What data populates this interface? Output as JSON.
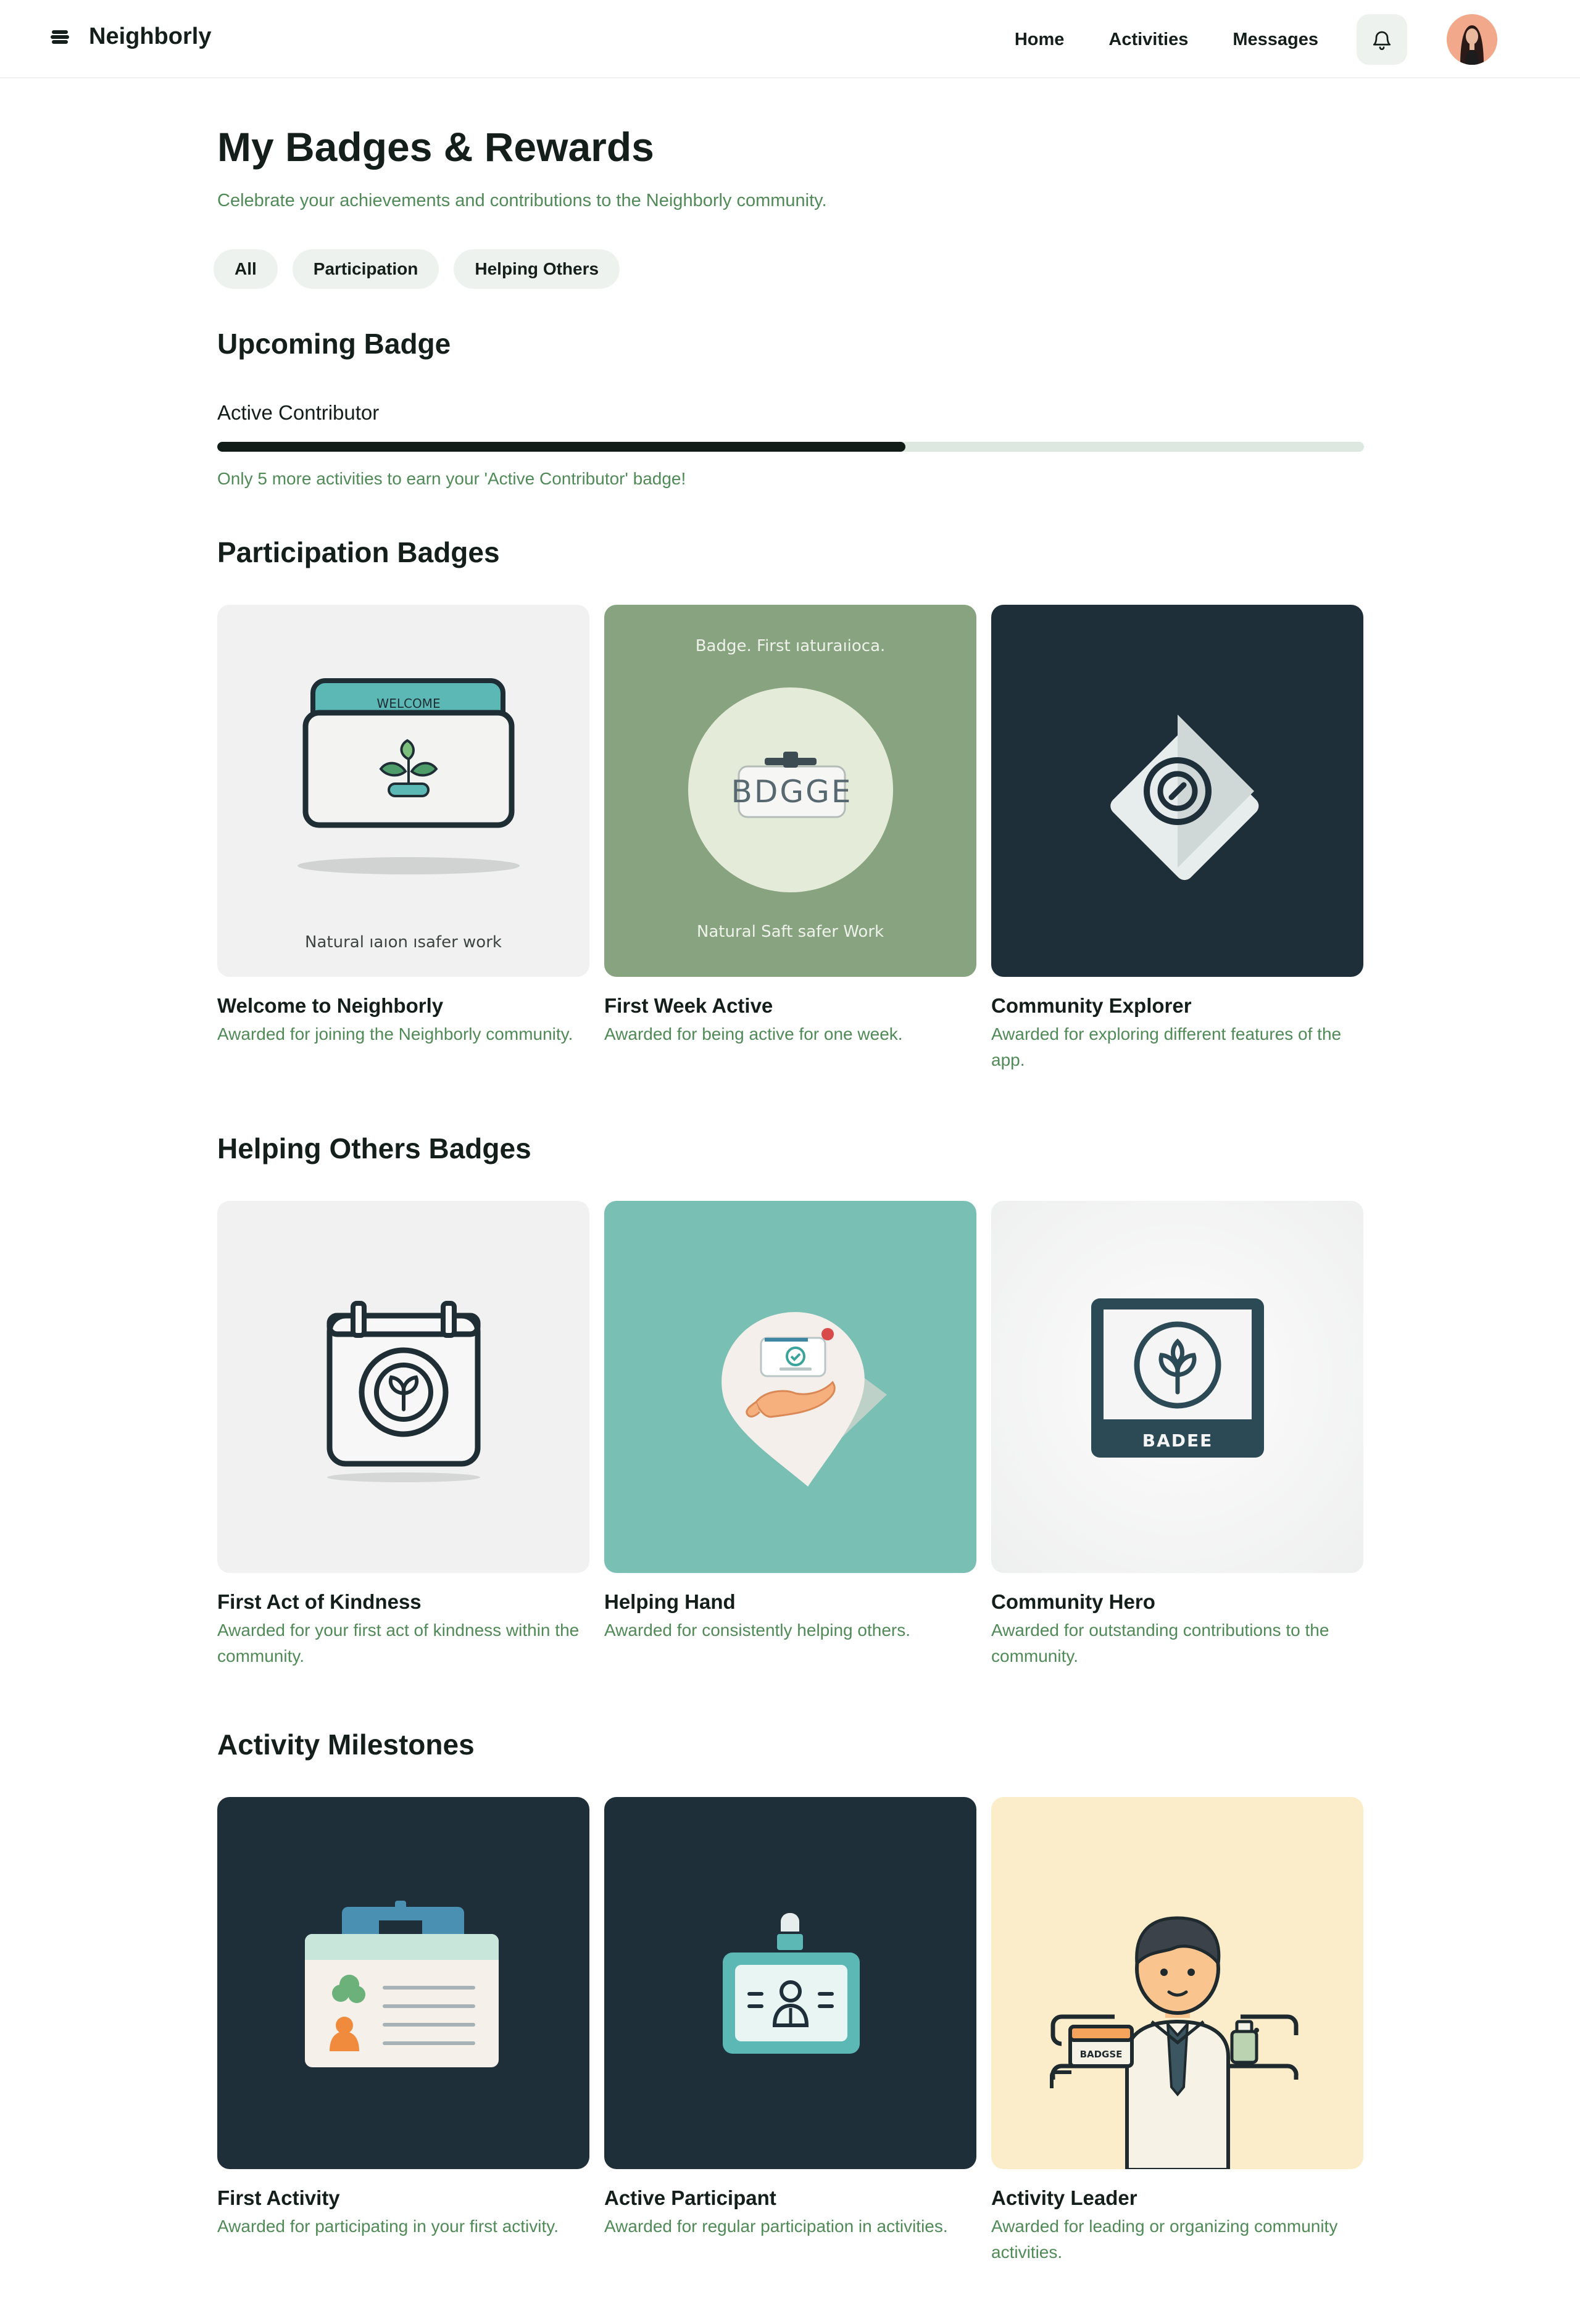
{
  "header": {
    "brand": "Neighborly",
    "nav": [
      "Home",
      "Activities",
      "Messages"
    ]
  },
  "page": {
    "title": "My Badges & Rewards",
    "subtitle": "Celebrate your achievements and contributions to the Neighborly community."
  },
  "filters": [
    "All",
    "Participation",
    "Helping Others"
  ],
  "upcoming": {
    "heading": "Upcoming Badge",
    "badge_name": "Active Contributor",
    "progress_fraction": 0.6,
    "note": "Only 5 more activities to earn your 'Active Contributor' badge!"
  },
  "sections": [
    {
      "title": "Participation Badges",
      "badges": [
        {
          "title": "Welcome to Neighborly",
          "desc": "Awarded for joining the Neighborly community.",
          "art_text": "WELCOME",
          "caption": "Natural ıaıon ısafer work"
        },
        {
          "title": "First Week Active",
          "desc": "Awarded for being active for one week.",
          "art_text": "BDGGE",
          "top_caption": "Badge. First ıaturaıioca.",
          "caption": "Natural Saft safer Work"
        },
        {
          "title": "Community Explorer",
          "desc": "Awarded for exploring different features of the app."
        }
      ]
    },
    {
      "title": "Helping Others Badges",
      "badges": [
        {
          "title": "First Act of Kindness",
          "desc": "Awarded for your first act of kindness within the community."
        },
        {
          "title": "Helping Hand",
          "desc": "Awarded for consistently helping others."
        },
        {
          "title": "Community Hero",
          "desc": "Awarded for outstanding contributions to the community.",
          "art_text": "BADEE"
        }
      ]
    },
    {
      "title": "Activity Milestones",
      "badges": [
        {
          "title": "First Activity",
          "desc": "Awarded for participating in your first activity."
        },
        {
          "title": "Active Participant",
          "desc": "Awarded for regular participation in activities."
        },
        {
          "title": "Activity Leader",
          "desc": "Awarded for leading or organizing community activities.",
          "art_text": "BADGSE"
        }
      ]
    }
  ],
  "colors": {
    "accent_green": "#4f8a57",
    "dark_navy": "#1e2f3a",
    "teal": "#79bfb4",
    "sage": "#88a37f",
    "cream": "#fbedca",
    "light_gray": "#f0f1f0",
    "progress_fill": "#111b18",
    "progress_track": "#dde8e0"
  },
  "icons": [
    "menu-logo-icon",
    "bell-icon",
    "user-avatar"
  ]
}
